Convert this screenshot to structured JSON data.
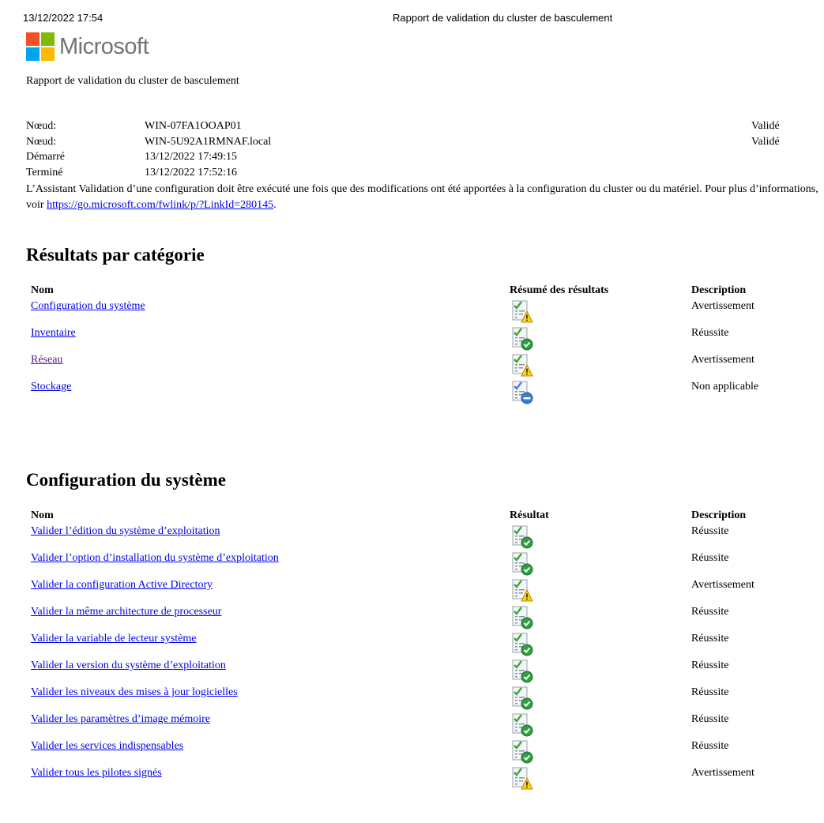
{
  "header": {
    "date": "13/12/2022 17:54",
    "title": "Rapport de validation du cluster de basculement"
  },
  "logo": {
    "text": "Microsoft",
    "colors": [
      "#f25022",
      "#7fba00",
      "#00a4ef",
      "#ffb900"
    ]
  },
  "subtitle": "Rapport de validation du cluster de basculement",
  "meta": [
    {
      "label": "Nœud:",
      "value": "WIN-07FA1OOAP01",
      "status": "Validé"
    },
    {
      "label": "Nœud:",
      "value": "WIN-5U92A1RMNAF.local",
      "status": "Validé"
    },
    {
      "label": "Démarré",
      "value": "13/12/2022 17:49:15",
      "status": ""
    },
    {
      "label": "Terminé",
      "value": "13/12/2022 17:52:16",
      "status": ""
    }
  ],
  "intro": {
    "text": "L’Assistant Validation d’une configuration doit être exécuté une fois que des modifications ont été apportées à la configuration du cluster ou du matériel. Pour plus d’informations,",
    "link_prefix": "voir ",
    "link": "https://go.microsoft.com/fwlink/p/?LinkId=280145",
    "link_suffix": "."
  },
  "results_by_category": {
    "title": "Résultats par catégorie",
    "col_name": "Nom",
    "col_result": "Résumé des résultats",
    "col_desc": "Description",
    "rows": [
      {
        "name": "Configuration du système",
        "icon": "warning",
        "desc": "Avertissement"
      },
      {
        "name": "Inventaire",
        "icon": "success",
        "desc": "Réussite"
      },
      {
        "name": "Réseau",
        "icon": "warning",
        "desc": "Avertissement"
      },
      {
        "name": "Stockage",
        "icon": "not-applicable",
        "desc": "Non applicable"
      }
    ]
  },
  "system_config": {
    "title": "Configuration du système",
    "col_name": "Nom",
    "col_result": "Résultat",
    "col_desc": "Description",
    "rows": [
      {
        "name": "Valider l’édition du système d’exploitation",
        "icon": "success",
        "desc": "Réussite"
      },
      {
        "name": "Valider l’option d’installation du système d’exploitation",
        "icon": "success",
        "desc": "Réussite"
      },
      {
        "name": "Valider la configuration Active Directory",
        "icon": "warning",
        "desc": "Avertissement"
      },
      {
        "name": "Valider la même architecture de processeur",
        "icon": "success",
        "desc": "Réussite"
      },
      {
        "name": "Valider la variable de lecteur système",
        "icon": "success",
        "desc": "Réussite"
      },
      {
        "name": "Valider la version du système d’exploitation",
        "icon": "success",
        "desc": "Réussite"
      },
      {
        "name": "Valider les niveaux des mises à jour logicielles",
        "icon": "success",
        "desc": "Réussite"
      },
      {
        "name": "Valider les paramètres d’image mémoire",
        "icon": "success",
        "desc": "Réussite"
      },
      {
        "name": "Valider les services indispensables",
        "icon": "success",
        "desc": "Réussite"
      },
      {
        "name": "Valider tous les pilotes signés",
        "icon": "warning",
        "desc": "Avertissement"
      }
    ]
  }
}
